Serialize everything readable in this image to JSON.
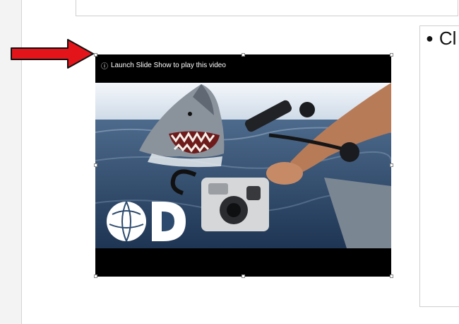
{
  "slide": {
    "bullet_text": "Cl"
  },
  "video": {
    "banner_text": "Launch Slide Show to play this video",
    "banner_icon": "info-icon",
    "thumbnail_subject": "great white shark breaching near underwater camera rig",
    "logo": "discovery-logo"
  },
  "annotation": {
    "arrow_color": "#e3151b"
  },
  "colors": {
    "video_background": "#000000",
    "sea": "#2c4a6d",
    "sky": "#e6eef6"
  }
}
